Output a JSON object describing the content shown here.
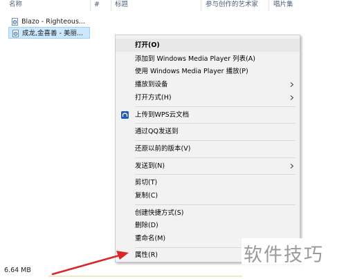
{
  "columns": {
    "name": "名称",
    "number": "#",
    "title": "标题",
    "contributing_artists": "参与创作的艺术家",
    "album": "唱片集"
  },
  "files": [
    {
      "name": "Blazo - Righteous...",
      "selected": false,
      "icon": "audio-file-icon"
    },
    {
      "name": "成龙,金喜善 - 美丽...",
      "selected": true,
      "icon": "audio-file-icon"
    }
  ],
  "context_menu": {
    "items": [
      {
        "label": "打开(O)",
        "bold": true,
        "highlighted": true
      },
      {
        "label": "添加到 Windows Media Player 列表(A)"
      },
      {
        "label": "使用 Windows Media Player 播放(P)"
      },
      {
        "label": "播放到设备",
        "submenu": true
      },
      {
        "label": "打开方式(H)",
        "submenu": true
      },
      {
        "label": "上传到WPS云文档",
        "icon": "wps-cloud-icon"
      },
      {
        "label": "通过QQ发送到"
      },
      {
        "label": "还原以前的版本(V)"
      },
      {
        "label": "发送到(N)",
        "submenu": true
      },
      {
        "label": "剪切(T)"
      },
      {
        "label": "复制(C)"
      },
      {
        "label": "创建快捷方式(S)"
      },
      {
        "label": "删除(D)"
      },
      {
        "label": "重命名(M)"
      },
      {
        "label": "属性(R)"
      }
    ]
  },
  "status_bar": {
    "size": "6.64 MB"
  },
  "watermark": "软件技巧",
  "colors": {
    "selection": "#cce8ff",
    "annotation_arrow": "#d9262a",
    "menu_bg": "#f2f2f2"
  }
}
